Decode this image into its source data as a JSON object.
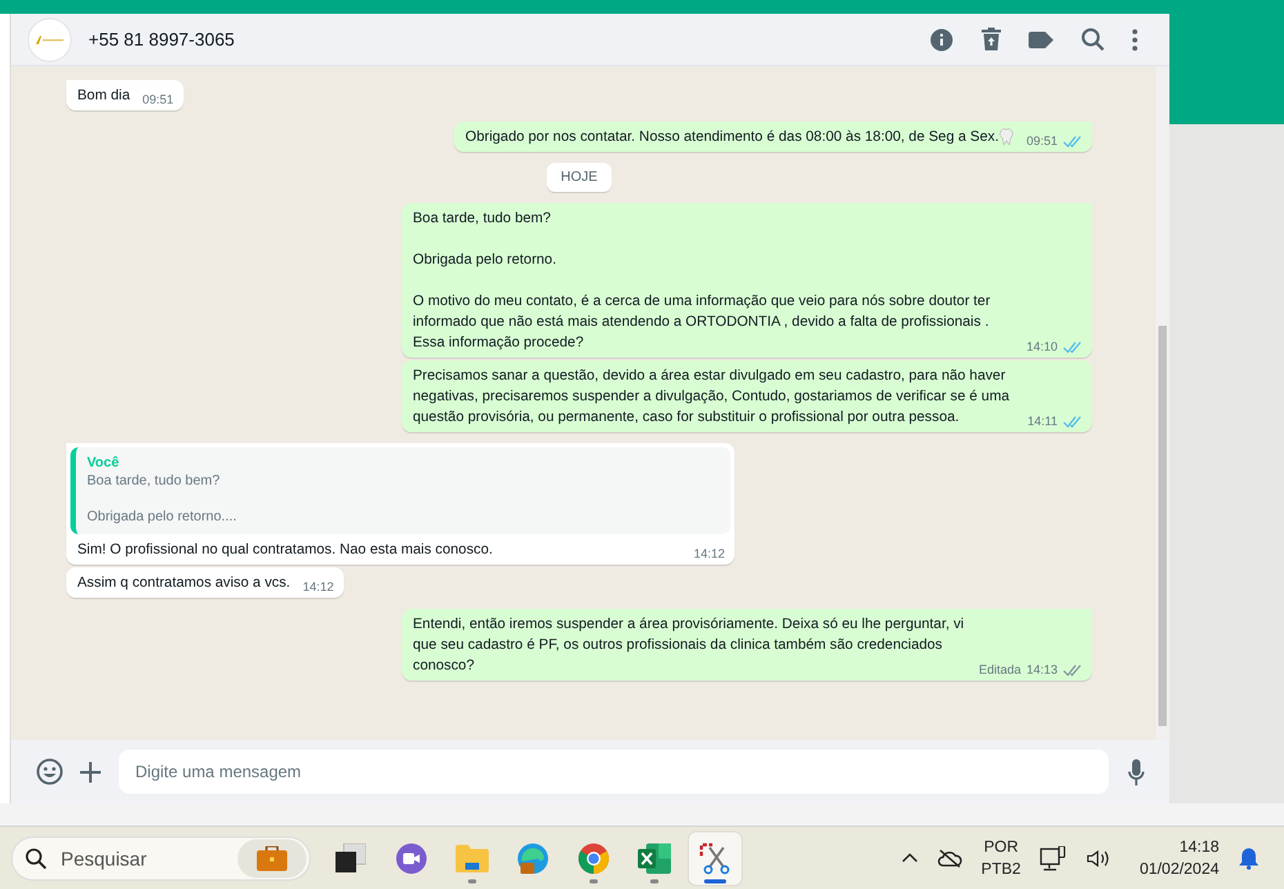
{
  "chat": {
    "contact": "+55 81 8997-3065"
  },
  "messages": [
    {
      "kind": "message",
      "outgoing": false,
      "text": "Bom dia",
      "time": "09:51"
    },
    {
      "kind": "message",
      "outgoing": true,
      "text": "Obrigado por nos contatar. Nosso atendimento é das 08:00 às 18:00, de Seg a Sex.",
      "tooth_emoji": true,
      "time": "09:51",
      "read": true
    },
    {
      "kind": "date",
      "text": "HOJE"
    },
    {
      "kind": "message",
      "outgoing": true,
      "text": "Boa tarde, tudo bem?\n\nObrigada pelo retorno.\n\nO motivo do meu contato, é a cerca de uma informação que veio para nós sobre doutor ter informado que não está mais atendendo a ORTODONTIA , devido a falta de profissionais . Essa informação procede?",
      "time": "14:10",
      "read": true
    },
    {
      "kind": "message",
      "outgoing": true,
      "text": "Precisamos sanar a questão, devido a área estar divulgado em seu cadastro, para não haver negativas, precisaremos suspender a divulgação, Contudo, gostariamos de verificar se é uma questão provisória, ou permanente, caso for substituir o profissional por outra pessoa.",
      "time": "14:11",
      "read": true
    },
    {
      "kind": "message",
      "outgoing": false,
      "quote": {
        "author": "Você",
        "text": "Boa tarde, tudo bem?\n\nObrigada pelo retorno...."
      },
      "text": "Sim! O profissional no qual contratamos. Nao esta mais conosco.",
      "time": "14:12"
    },
    {
      "kind": "message",
      "outgoing": false,
      "text": "Assim q contratamos aviso a vcs.",
      "time": "14:12"
    },
    {
      "kind": "message",
      "outgoing": true,
      "text": "Entendi, então iremos suspender a área provisóriamente. Deixa só eu lhe perguntar, vi que seu cadastro é PF, os outros profissionais da clinica também são credenciados conosco?",
      "edited": "Editada",
      "time": "14:13",
      "read": false
    }
  ],
  "composer": {
    "placeholder": "Digite uma mensagem"
  },
  "taskbar": {
    "search": {
      "placeholder": "Pesquisar"
    },
    "apps": [
      {
        "kind": "task-view",
        "running": false,
        "selected": false
      },
      {
        "kind": "meet",
        "running": false,
        "selected": false
      },
      {
        "kind": "folder",
        "running": true,
        "selected": false
      },
      {
        "kind": "edge",
        "running": false,
        "selected": false
      },
      {
        "kind": "chrome",
        "running": true,
        "selected": false
      },
      {
        "kind": "excel",
        "running": true,
        "selected": false
      },
      {
        "kind": "snip",
        "running": true,
        "selected": true
      }
    ],
    "language": [
      "POR",
      "PTB2"
    ],
    "time": "14:18",
    "date": "01/02/2024"
  }
}
